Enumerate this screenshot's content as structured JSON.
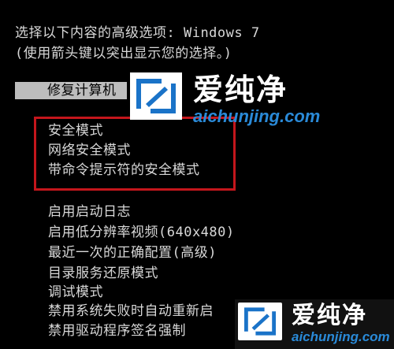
{
  "header": {
    "line1": "选择以下内容的高级选项: Windows 7",
    "line2": "(使用箭头键以突出显示您的选择。)"
  },
  "menu": {
    "selected": "修复计算机",
    "highlighted_group": [
      "安全模式",
      "网络安全模式",
      "带命令提示符的安全模式"
    ],
    "other_options": [
      "启用启动日志",
      "启用低分辨率视频(640x480)",
      "最近一次的正确配置(高级)",
      "目录服务还原模式",
      "调试模式",
      "禁用系统失败时自动重新启",
      "禁用驱动程序签名强制"
    ]
  },
  "watermark": {
    "brand": "爱纯净",
    "url": "aichunjing.com",
    "icon": "aichunjing-logo-icon"
  },
  "colors": {
    "background": "#000000",
    "text": "#d8d8d8",
    "selection_bar": "#bdbdbd",
    "highlight_border": "#c4161c",
    "watermark_url": "#2a8ad8"
  }
}
